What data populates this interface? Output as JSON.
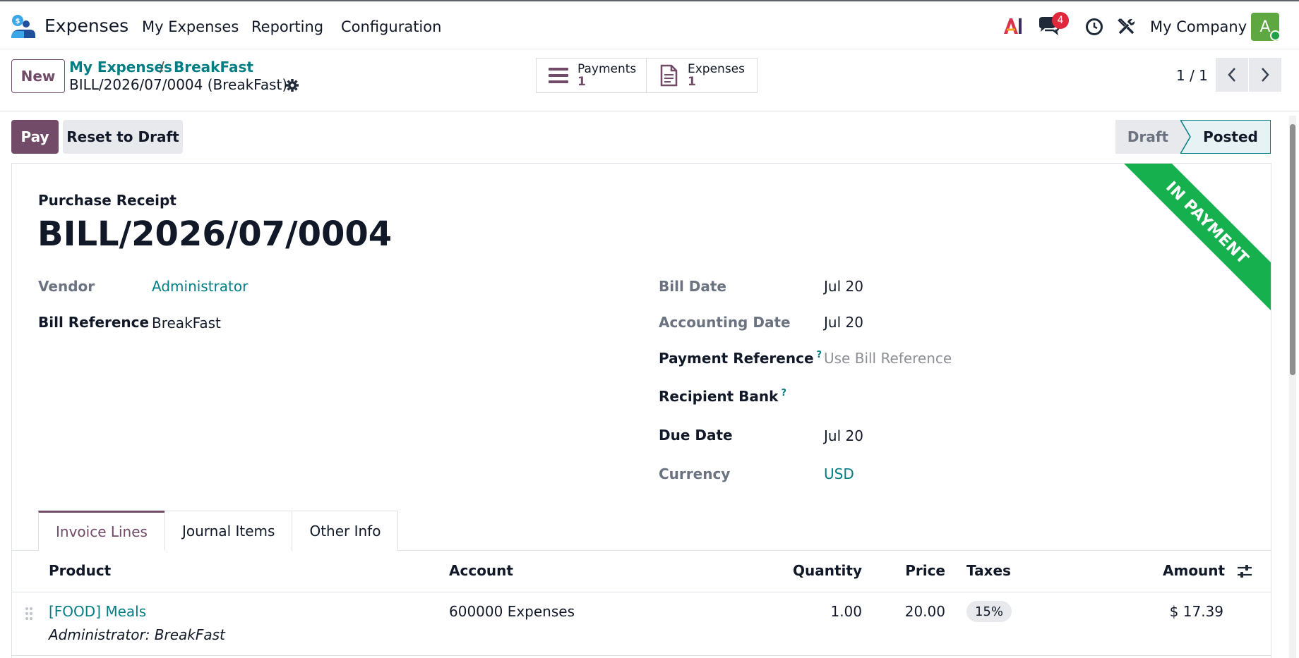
{
  "topbar": {
    "app_name": "Expenses",
    "menu": [
      "My Expenses",
      "Reporting",
      "Configuration"
    ],
    "messages_badge": "4",
    "company": "My Company",
    "avatar_letter": "A"
  },
  "control_panel": {
    "new_label": "New",
    "breadcrumb": [
      "My Expenses",
      "BreakFast"
    ],
    "breadcrumb_sep": "/",
    "current": "BILL/2026/07/0004 (BreakFast)",
    "smart_buttons": [
      {
        "label": "Payments",
        "value": "1"
      },
      {
        "label": "Expenses",
        "value": "1"
      }
    ],
    "pager": "1 / 1"
  },
  "statusbar": {
    "pay_label": "Pay",
    "reset_label": "Reset to Draft",
    "stages": [
      "Draft",
      "Posted"
    ]
  },
  "sheet": {
    "ribbon": "IN PAYMENT",
    "doc_type": "Purchase Receipt",
    "doc_name": "BILL/2026/07/0004",
    "left_fields": [
      {
        "label": "Vendor",
        "value": "Administrator"
      },
      {
        "label": "Bill Reference",
        "value": "BreakFast"
      }
    ],
    "right_fields": [
      {
        "label": "Bill Date",
        "value": "Jul 20"
      },
      {
        "label": "Accounting Date",
        "value": "Jul 20"
      },
      {
        "label": "Payment Reference",
        "value": "Use Bill Reference",
        "help": "?"
      },
      {
        "label": "Recipient Bank",
        "value": "",
        "help": "?"
      },
      {
        "label": "Due Date",
        "value": "Jul 20"
      },
      {
        "label": "Currency",
        "value": "USD"
      }
    ],
    "tabs": [
      "Invoice Lines",
      "Journal Items",
      "Other Info"
    ],
    "table": {
      "headers": [
        "Product",
        "Account",
        "Quantity",
        "Price",
        "Taxes",
        "Amount"
      ],
      "rows": [
        {
          "product": "[FOOD] Meals",
          "description": "Administrator: BreakFast",
          "account": "600000 Expenses",
          "quantity": "1.00",
          "price": "20.00",
          "taxes": "15%",
          "amount": "$ 17.39"
        }
      ]
    }
  },
  "colors": {
    "primary": "#714b67",
    "link": "#017e84",
    "ribbon": "#16b04f"
  }
}
